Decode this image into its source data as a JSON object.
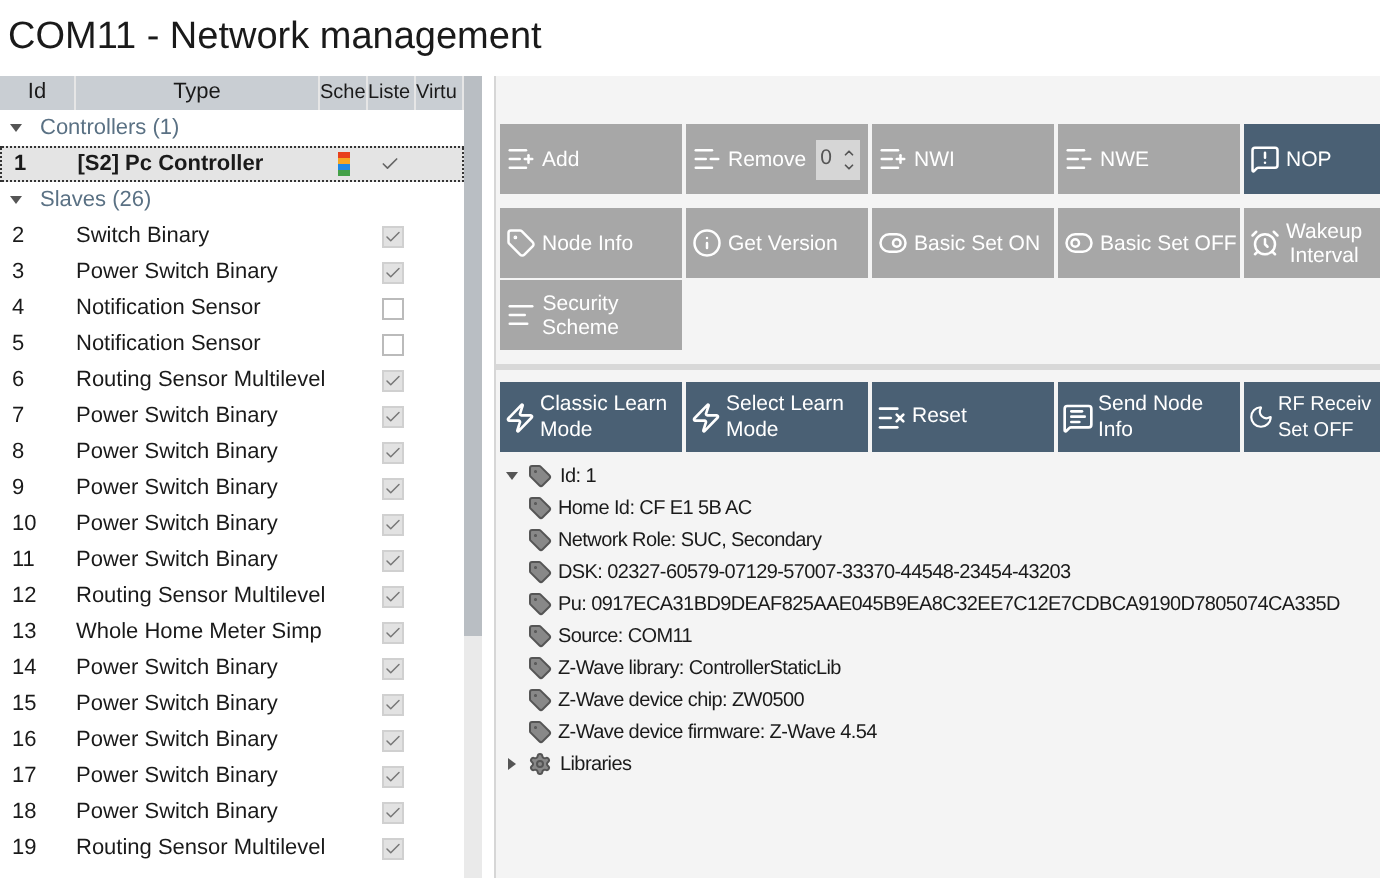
{
  "window": {
    "title": "COM11 - Network management"
  },
  "node_table": {
    "columns": [
      "Id",
      "Type",
      "Sche",
      "Liste",
      "Virtu"
    ],
    "groups": [
      {
        "label": "Controllers (1)",
        "expanded": true,
        "rows": [
          {
            "kind": "controller",
            "id": "1",
            "type": "[S2] Pc Controller",
            "selected": true,
            "scheme_bars": [
              {
                "color": "#e8401c"
              },
              {
                "color": "#f5a623"
              },
              {
                "color": "#1e88e5"
              },
              {
                "color": "#43a047"
              }
            ],
            "listening": true
          }
        ]
      },
      {
        "label": "Slaves (26)",
        "expanded": true,
        "rows": [
          {
            "kind": "slave",
            "id": "2",
            "type": "Switch Binary",
            "selected": false,
            "listening": true
          },
          {
            "kind": "slave",
            "id": "3",
            "type": "Power Switch Binary",
            "selected": false,
            "listening": true
          },
          {
            "kind": "slave",
            "id": "4",
            "type": "Notification Sensor",
            "selected": false,
            "listening": false
          },
          {
            "kind": "slave",
            "id": "5",
            "type": "Notification Sensor",
            "selected": false,
            "listening": false
          },
          {
            "kind": "slave",
            "id": "6",
            "type": "Routing Sensor Multilevel",
            "selected": false,
            "listening": true
          },
          {
            "kind": "slave",
            "id": "7",
            "type": "Power Switch Binary",
            "selected": false,
            "listening": true
          },
          {
            "kind": "slave",
            "id": "8",
            "type": "Power Switch Binary",
            "selected": false,
            "listening": true
          },
          {
            "kind": "slave",
            "id": "9",
            "type": "Power Switch Binary",
            "selected": false,
            "listening": true
          },
          {
            "kind": "slave",
            "id": "10",
            "type": "Power Switch Binary",
            "selected": false,
            "listening": true
          },
          {
            "kind": "slave",
            "id": "11",
            "type": "Power Switch Binary",
            "selected": false,
            "listening": true
          },
          {
            "kind": "slave",
            "id": "12",
            "type": "Routing Sensor Multilevel",
            "selected": false,
            "listening": true
          },
          {
            "kind": "slave",
            "id": "13",
            "type": "Whole Home Meter Simp",
            "selected": false,
            "listening": true
          },
          {
            "kind": "slave",
            "id": "14",
            "type": "Power Switch Binary",
            "selected": false,
            "listening": true
          },
          {
            "kind": "slave",
            "id": "15",
            "type": "Power Switch Binary",
            "selected": false,
            "listening": true
          },
          {
            "kind": "slave",
            "id": "16",
            "type": "Power Switch Binary",
            "selected": false,
            "listening": true
          },
          {
            "kind": "slave",
            "id": "17",
            "type": "Power Switch Binary",
            "selected": false,
            "listening": true
          },
          {
            "kind": "slave",
            "id": "18",
            "type": "Power Switch Binary",
            "selected": false,
            "listening": true
          },
          {
            "kind": "slave",
            "id": "19",
            "type": "Routing Sensor Multilevel",
            "selected": false,
            "listening": true
          }
        ]
      }
    ]
  },
  "toolbar": {
    "rows": [
      [
        {
          "kind": "add",
          "label": "Add",
          "highlighted": false
        },
        {
          "kind": "remove",
          "label": "Remove",
          "highlighted": false,
          "spin_value": "0"
        },
        {
          "kind": "add",
          "label": "NWI",
          "highlighted": false
        },
        {
          "kind": "remove",
          "label": "NWE",
          "highlighted": false
        },
        {
          "kind": "alert",
          "label": "NOP",
          "highlighted": true
        }
      ],
      [
        {
          "kind": "tag",
          "label": "Node Info",
          "highlighted": false
        },
        {
          "kind": "info",
          "label": "Get Version",
          "highlighted": false
        },
        {
          "kind": "on",
          "label": "Basic Set ON",
          "highlighted": false
        },
        {
          "kind": "off",
          "label": "Basic Set OFF",
          "highlighted": false
        },
        {
          "kind": "alarm",
          "label": "Wakeup\nInterval",
          "highlighted": false
        }
      ],
      [
        {
          "kind": "lines",
          "label": "Security\nScheme",
          "highlighted": false
        }
      ]
    ]
  },
  "learn_toolbar": [
    {
      "kind": "bolt",
      "label": "Classic Learn\nMode"
    },
    {
      "kind": "bolt",
      "label": "Select Learn\nMode"
    },
    {
      "kind": "reset",
      "label": "Reset"
    },
    {
      "kind": "message",
      "label": "Send Node\nInfo"
    },
    {
      "kind": "sleep",
      "label": "RF Receiv\nSet OFF"
    }
  ],
  "info_tree": [
    {
      "kind": "tag",
      "label": "Id: 1",
      "expanded": true,
      "children": [
        {
          "kind": "tag",
          "label": "Home Id: CF E1 5B AC"
        },
        {
          "kind": "tag",
          "label": "Network Role: SUC, Secondary"
        },
        {
          "kind": "tag",
          "label": "DSK: 02327-60579-07129-57007-33370-44548-23454-43203"
        },
        {
          "kind": "tag",
          "label": "Pu: 0917ECA31BD9DEAF825AAE045B9EA8C32EE7C12E7CDBCA9190D7805074CA335D"
        },
        {
          "kind": "tag",
          "label": "Source: COM11"
        },
        {
          "kind": "tag",
          "label": "Z-Wave library: ControllerStaticLib"
        },
        {
          "kind": "tag",
          "label": "Z-Wave device chip: ZW0500"
        },
        {
          "kind": "tag",
          "label": "Z-Wave device firmware: Z-Wave 4.54"
        }
      ]
    },
    {
      "kind": "gear",
      "label": "Libraries",
      "expanded": false
    }
  ]
}
